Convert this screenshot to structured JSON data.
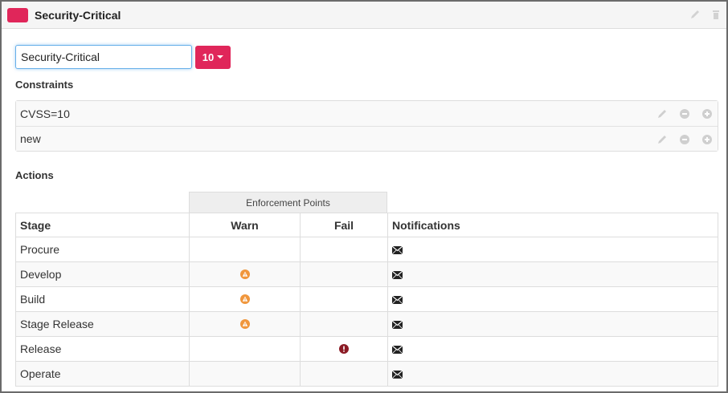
{
  "policy": {
    "title": "Security-Critical",
    "color": "#e0265a",
    "name_value": "Security-Critical",
    "score_label": "10"
  },
  "constraints": {
    "label": "Constraints",
    "items": [
      {
        "text": "CVSS=10"
      },
      {
        "text": "new"
      }
    ]
  },
  "actions": {
    "label": "Actions",
    "enforcement_header": "Enforcement Points",
    "columns": [
      "Stage",
      "Warn",
      "Fail",
      "Notifications"
    ],
    "rows": [
      {
        "stage": "Procure",
        "warn": false,
        "fail": false,
        "notify": true
      },
      {
        "stage": "Develop",
        "warn": true,
        "fail": false,
        "notify": true
      },
      {
        "stage": "Build",
        "warn": true,
        "fail": false,
        "notify": true
      },
      {
        "stage": "Stage Release",
        "warn": true,
        "fail": false,
        "notify": true
      },
      {
        "stage": "Release",
        "warn": false,
        "fail": true,
        "notify": true
      },
      {
        "stage": "Operate",
        "warn": false,
        "fail": false,
        "notify": true
      }
    ]
  },
  "colors": {
    "warn": "#f0963c",
    "fail": "#8b1a24",
    "tool_icon": "#c8c8c8"
  },
  "icons": {
    "edit": "pencil-icon",
    "delete": "trash-icon",
    "remove": "minus-circle-icon",
    "add": "plus-circle-icon",
    "warn": "warning-icon",
    "fail": "error-icon",
    "notify": "envelope-icon"
  }
}
